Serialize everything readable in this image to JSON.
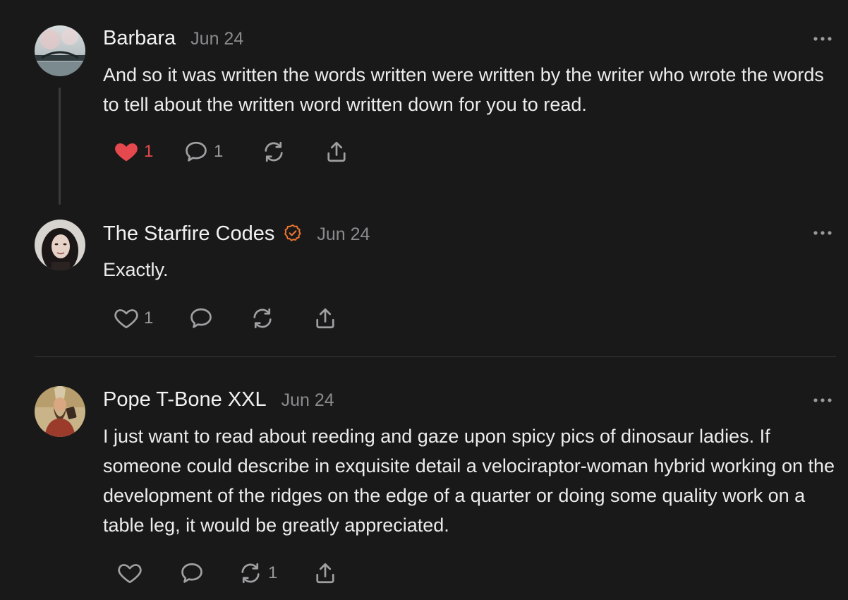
{
  "comments": [
    {
      "author": "Barbara",
      "date": "Jun 24",
      "verified": false,
      "text": "And so it was written the words written were written by the writer who wrote the words to tell about the written word written down for you to read.",
      "likes": "1",
      "replies": "1",
      "restacks": "",
      "liked": true
    },
    {
      "author": "The Starfire Codes",
      "date": "Jun 24",
      "verified": true,
      "text": "Exactly.",
      "likes": "1",
      "replies": "",
      "restacks": "",
      "liked": false
    },
    {
      "author": "Pope T-Bone XXL",
      "date": "Jun 24",
      "verified": false,
      "text": "I just want to read about reeding and gaze upon spicy pics of dinosaur ladies. If someone could describe in exquisite detail a velociraptor-woman hybrid working on the development of the ridges on the edge of a quarter or doing some quality work on a table leg, it would be greatly appreciated.",
      "likes": "",
      "replies": "",
      "restacks": "1",
      "liked": false
    }
  ],
  "icons": {
    "heart": "heart-icon",
    "reply": "speech-bubble-icon",
    "restack": "restack-icon",
    "share": "share-icon",
    "more": "more-horizontal-icon",
    "verified": "verified-badge-icon"
  },
  "colors": {
    "background": "#19191a",
    "liked": "#e5484d",
    "verified": "#f0772f",
    "muted": "#8b8b8e"
  }
}
